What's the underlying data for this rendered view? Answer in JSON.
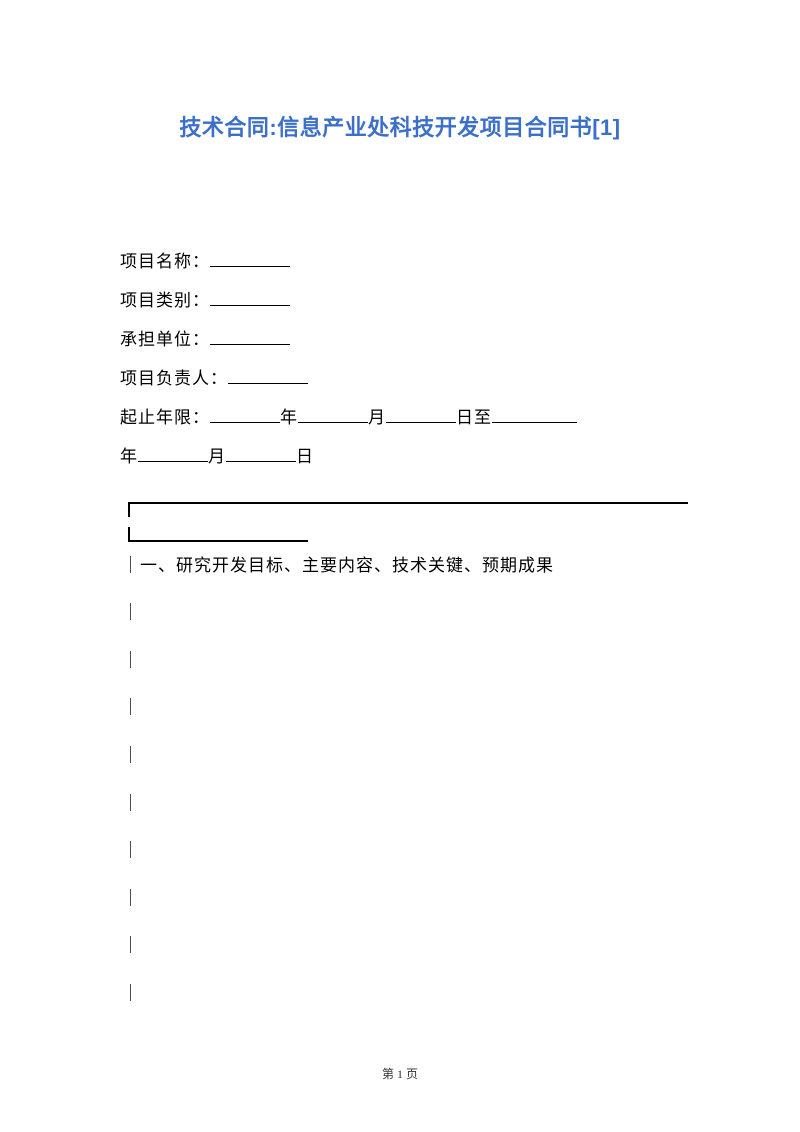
{
  "title": "技术合同:信息产业处科技开发项目合同书[1]",
  "fields": {
    "project_name_label": "项目名称：",
    "project_category_label": "项目类别：",
    "undertaking_unit_label": "承担单位：",
    "project_leader_label": "项目负责人：",
    "duration_label": "起止年限：",
    "year_char": "年",
    "month_char": "月",
    "day_char": "日",
    "to_char": "至",
    "year2_prefix": "年",
    "month2_char": "月",
    "day2_char": "日"
  },
  "section_one": "｜一、研究开发目标、主要内容、技术关键、预期成果",
  "vertical_bar": "｜",
  "page_footer": "第 1 页"
}
